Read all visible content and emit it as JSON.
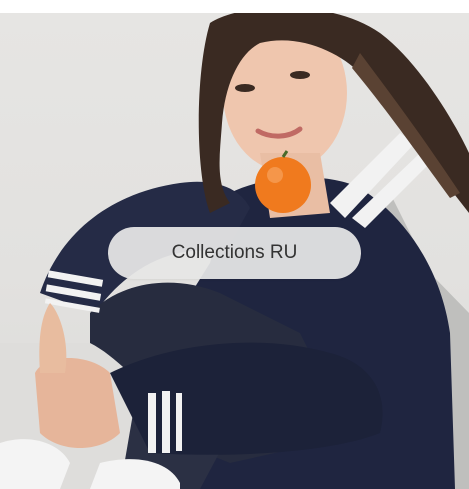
{
  "collection_card": {
    "button_label": "Collections RU",
    "image_icon": "person-photo",
    "colors": {
      "background": "#e4e3e1",
      "pill_background": "#e6e6e6",
      "pill_text": "#333333",
      "jacket": "#1f2540",
      "sleeve": "#c3c3c1",
      "orange": "#f07a1e"
    }
  }
}
